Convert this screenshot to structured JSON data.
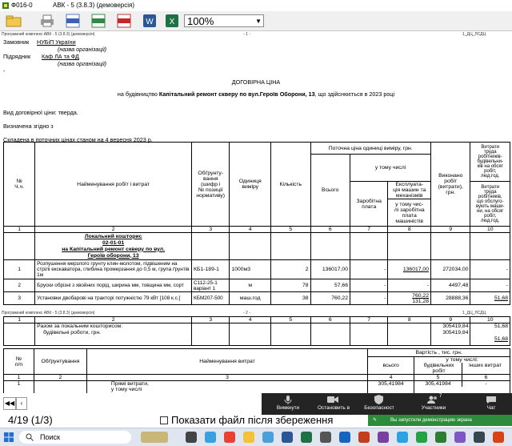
{
  "window": {
    "title": "Ф016-0",
    "subtitle": "АВК - 5 (3.8.3)  (демоверсія)"
  },
  "toolbar": {
    "zoom_value": "100%"
  },
  "doc": {
    "header_left": "Програмний комплекс АВК - 5 (3.8.3)  (демоверсія)",
    "header_center_p1": "- 1 -",
    "header_right": "1_ДЦ_ЛСДЦ",
    "customer_label": "Замовник",
    "customer_value": "НУБіП України",
    "customer_hint": "(назва організації)",
    "contractor_label": "Підрядник",
    "contractor_value": "Каф ЛА та ФД",
    "contractor_hint": "(назва організації)",
    "dash": "-",
    "title": "ДОГОВІРНА ЦІНА",
    "construction_pre": "на будівництво",
    "construction_name": "Капітальний ремонт скверу по вул.Героїв Оборони, 13",
    "construction_post": ", що здійснюється в  2023 році",
    "price_type": "Вид договірної ціни: тверда.",
    "determined": "Визначена згідно з",
    "compiled": "Складена в поточних цінах станом на  4 вересня 2023  р.",
    "table1": {
      "h_num": "№\nЧ.ч.",
      "h_name": "Найменування робіт і витрат",
      "h_basis": "Обґрунту-\nвання\n(шифр і\n№ позиції\nнормативу)",
      "h_unit": "Одиниця\nвиміру",
      "h_qty": "Кількість",
      "h_current": "Поточна ціна одиниці виміру, грн.",
      "h_total": "Всього",
      "h_incl": "у тому числі",
      "h_wage": "Заробітна\nплата",
      "h_oper": "Експлуата-\nція машин та\nмеханізмів",
      "h_oper_wage": "у тому чис-\nлі заробітна\nплата\nмашиністів",
      "h_done": "Виконано\nробіт\n(витрати),\nгрн.",
      "h_labor": "Витрати\nтруда\nробітників-\nбудівельни-\nків на обсяг\nробіт,\nлюд.год.",
      "h_labor2": "Витрати\nтруда\nробітників,\nщо обслуго-\nвують маши-\nни, на обсяг\nробіт,\nлюд.год.",
      "colnums": [
        "1",
        "2",
        "3",
        "4",
        "5",
        "6",
        "7",
        "8",
        "9",
        "10"
      ],
      "section_title": "Локальний кошторис",
      "section_code": "02-01-01",
      "section_name": "на Капітальний ремонт скверу по вул.",
      "section_name2": "Героїв оборони, 13",
      "rows": [
        {
          "n": "1",
          "name": "Розпушення мерзлого грунту клин-молотом, підвішеним на стрілі екскаватора, глибина промерзання до 0,5 м, група ґрунтів 1м",
          "basis": "КБ1-189-1",
          "unit": "1000м3",
          "qty": "2",
          "total": "136017,00",
          "wage": "-",
          "oper": "136017,00",
          "oper_wage": "-",
          "done": "272034,00",
          "labor": "-",
          "labor2": "-"
        },
        {
          "n": "2",
          "name": "Бруски обрізні з хвойних порід, ширина мм, товщина мм, сорт",
          "basis": "С112-25-1 варіант 1",
          "unit": "м",
          "qty": "78",
          "total": "57,66",
          "wage": "-",
          "oper": "-",
          "oper_wage": "-",
          "done": "4497,48",
          "labor": "-",
          "labor2": "-"
        },
        {
          "n": "3",
          "name": "Установки двобарові на тракторі потужністю 79 кВт [108 к.с.]",
          "basis": "КБМ207-500",
          "unit": "маш.год",
          "qty": "38",
          "total": "760,22",
          "wage": "-",
          "oper": "760,22",
          "oper_wage": "131,28",
          "done": "28888,36",
          "labor": "-",
          "labor2": "51,68"
        }
      ]
    },
    "header_center_p2": "- 2 -",
    "total_label": "Разом за локальним кошторисом:",
    "total_label2": "будівельні роботи,  грн.",
    "total_done": "305419,84",
    "total_done2": "305419,84",
    "total_labor": "51,68",
    "total_labor_sum": "51,68",
    "table2": {
      "h_num": "№\nп/п",
      "h_basis": "Обґрунтування",
      "h_name": "Найменування витрат",
      "h_cost": "Вартість , тис. грн.",
      "h_all": "всього",
      "h_incl": "у тому   числі:",
      "h_build": "будівельних\nробіт",
      "h_other": "інших витрат",
      "colnums": [
        "1",
        "2",
        "3",
        "4",
        "5",
        "6"
      ],
      "row_n": "1",
      "row_name": "Прямі витрати,\nу тому числі",
      "row_all": "305,41984",
      "row_build": "305,41984",
      "row_other": "-"
    }
  },
  "pager": {
    "page_info": "4/19 (1/3)",
    "show_file_label": "Показати файл після збереження"
  },
  "meeting": {
    "mute": "Вимкнути",
    "stop_video": "Остановить в",
    "security": "Безопасност",
    "participants": "Участники",
    "participants_count": "7",
    "chat": "Чат",
    "demo_banner": "Вы запустили демонстрацию экрана"
  },
  "taskbar": {
    "search": "Поиск"
  }
}
